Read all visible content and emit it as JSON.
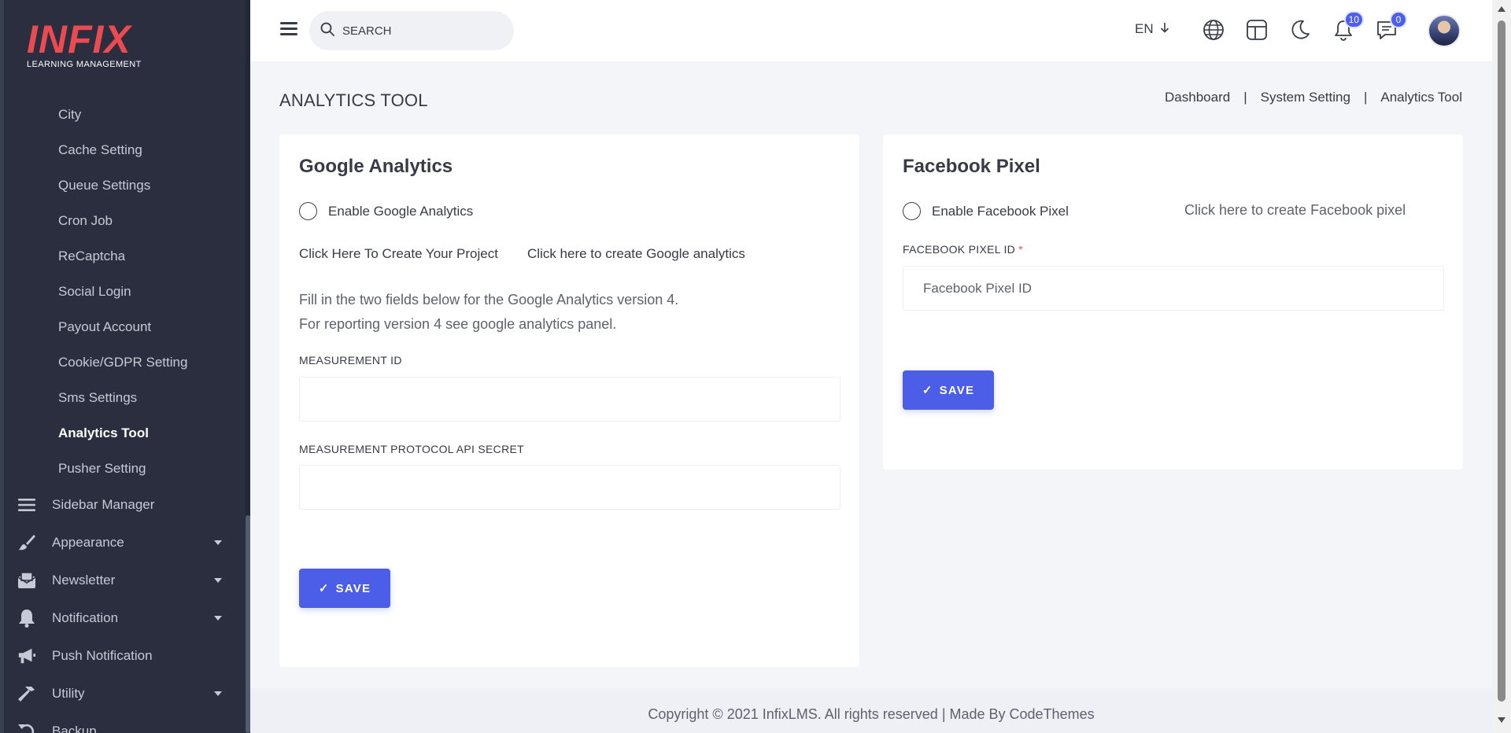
{
  "brand": {
    "logo": "INFIX",
    "tagline": "LEARNING MANAGEMENT",
    "accent": "#ea4b52"
  },
  "sidebar": {
    "sub_items": [
      {
        "label": "City",
        "active": false
      },
      {
        "label": "Cache Setting",
        "active": false
      },
      {
        "label": "Queue Settings",
        "active": false
      },
      {
        "label": "Cron Job",
        "active": false
      },
      {
        "label": "ReCaptcha",
        "active": false
      },
      {
        "label": "Social Login",
        "active": false
      },
      {
        "label": "Payout Account",
        "active": false
      },
      {
        "label": "Cookie/GDPR Setting",
        "active": false
      },
      {
        "label": "Sms Settings",
        "active": false
      },
      {
        "label": "Analytics Tool",
        "active": true
      },
      {
        "label": "Pusher Setting",
        "active": false
      }
    ],
    "menu": [
      {
        "label": "Sidebar Manager",
        "icon": "list-icon",
        "caret": false
      },
      {
        "label": "Appearance",
        "icon": "brush-icon",
        "caret": true
      },
      {
        "label": "Newsletter",
        "icon": "envelope-icon",
        "caret": true
      },
      {
        "label": "Notification",
        "icon": "bell-icon",
        "caret": true
      },
      {
        "label": "Push Notification",
        "icon": "megaphone-icon",
        "caret": false
      },
      {
        "label": "Utility",
        "icon": "hammer-icon",
        "caret": true
      },
      {
        "label": "Backup",
        "icon": "backup-icon",
        "caret": false
      }
    ]
  },
  "header": {
    "search_placeholder": "SEARCH",
    "language": "EN",
    "notification_count": "10",
    "message_count": "0"
  },
  "page": {
    "title": "ANALYTICS TOOL",
    "breadcrumb": [
      "Dashboard",
      "System Setting",
      "Analytics Tool"
    ]
  },
  "google": {
    "title": "Google Analytics",
    "enable_label": "Enable Google Analytics",
    "link_project": "Click Here To Create Your Project",
    "link_create": "Click here to create Google analytics",
    "desc_line1": "Fill in the two fields below for the Google Analytics version 4.",
    "desc_line2": "For reporting version 4 see google analytics panel.",
    "measurement_label": "MEASUREMENT ID",
    "measurement_value": "",
    "secret_label": "MEASUREMENT PROTOCOL API SECRET",
    "secret_value": "",
    "save_label": "SAVE"
  },
  "facebook": {
    "title": "Facebook Pixel",
    "enable_label": "Enable Facebook Pixel",
    "link_create": "Click here to create Facebook pixel",
    "pixel_label": "FACEBOOK PIXEL ID",
    "required_mark": "*",
    "pixel_placeholder": "Facebook Pixel ID",
    "save_label": "SAVE"
  },
  "footer": {
    "text": "Copyright © 2021 InfixLMS. All rights reserved | Made By CodeThemes"
  },
  "colors": {
    "primary": "#4c5ee8",
    "sidebar_bg": "#2a2e3e"
  }
}
